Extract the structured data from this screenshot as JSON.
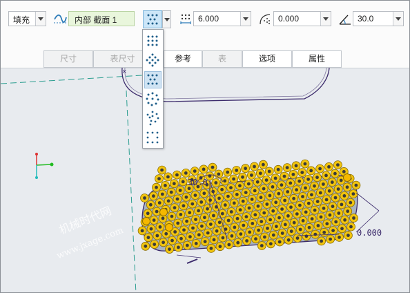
{
  "dashboard": {
    "fill_label": "填充",
    "section_type": "内部 截面 1",
    "pitch_value": "6.000",
    "offset_value": "0.000",
    "angle_value": "30.0"
  },
  "tabs": [
    {
      "label": "尺寸",
      "state": "disabled"
    },
    {
      "label": "表尺寸",
      "state": "disabled"
    },
    {
      "label": "参考",
      "state": "active"
    },
    {
      "label": "表",
      "state": "disabled"
    },
    {
      "label": "选项",
      "state": "active"
    },
    {
      "label": "属性",
      "state": "active"
    }
  ],
  "pattern_menu": {
    "items": [
      "square-grid-pattern-icon",
      "diamond-pattern-icon",
      "triangle-pattern-icon",
      "circle-pattern-icon",
      "spiral-pattern-icon",
      "square-border-pattern-icon"
    ],
    "selected_index": 2
  },
  "canvas": {
    "dim_angle_label": "30.0",
    "dim_offset_label": "0.000",
    "watermark_cn": "机械时代网",
    "watermark_url": "www.jxage.com"
  },
  "colors": {
    "dashboard_bg": "#fbfbfb",
    "graphics_bg": "#e8ebef",
    "selected_field": "#e9f6dc",
    "pattern_point_fill": "#f1c40f",
    "datum_line": "#2a9d8f",
    "dimension_line": "#3b2a6b"
  }
}
